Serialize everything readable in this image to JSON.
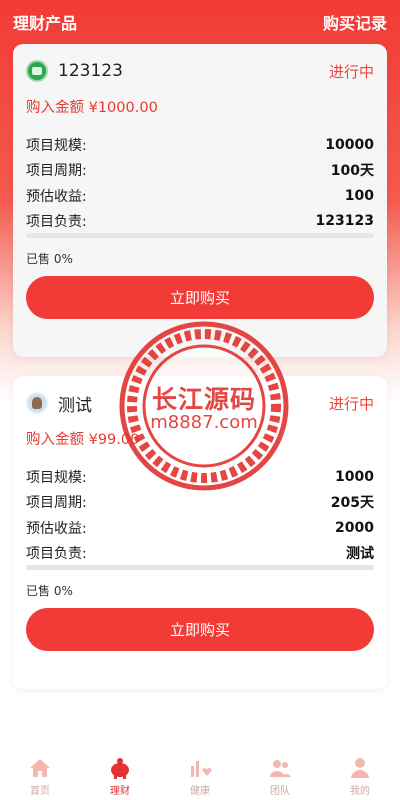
{
  "header": {
    "title": "理财产品",
    "records_link": "购买记录"
  },
  "products": [
    {
      "name": "123123",
      "status": "进行中",
      "amount": "购入金额 ¥1000.00",
      "rows": [
        {
          "label": "项目规模:",
          "value": "10000"
        },
        {
          "label": "项目周期:",
          "value": "100天"
        },
        {
          "label": "预估收益:",
          "value": "100"
        },
        {
          "label": "项目负责:",
          "value": "123123"
        }
      ],
      "progress_percent": 0,
      "sold": "已售 0%",
      "buy_label": "立即购买"
    },
    {
      "name": "测试",
      "status": "进行中",
      "amount": "购入金额 ¥99.00",
      "rows": [
        {
          "label": "项目规模:",
          "value": "1000"
        },
        {
          "label": "项目周期:",
          "value": "205天"
        },
        {
          "label": "预估收益:",
          "value": "2000"
        },
        {
          "label": "项目负责:",
          "value": "测试"
        }
      ],
      "progress_percent": 0,
      "sold": "已售 0%",
      "buy_label": "立即购买"
    }
  ],
  "watermark": {
    "title": "长江源码",
    "url": "m8887.com"
  },
  "tabbar": [
    {
      "label": "首页",
      "icon": "home-icon",
      "active": false
    },
    {
      "label": "理财",
      "icon": "piggy-bank-icon",
      "active": true
    },
    {
      "label": "健康",
      "icon": "health-chart-icon",
      "active": false
    },
    {
      "label": "团队",
      "icon": "team-icon",
      "active": false
    },
    {
      "label": "我的",
      "icon": "user-icon",
      "active": false
    }
  ],
  "colors": {
    "brand": "#f23a36",
    "status": "#f0453c",
    "tab_inactive": "#c9a8a4"
  }
}
